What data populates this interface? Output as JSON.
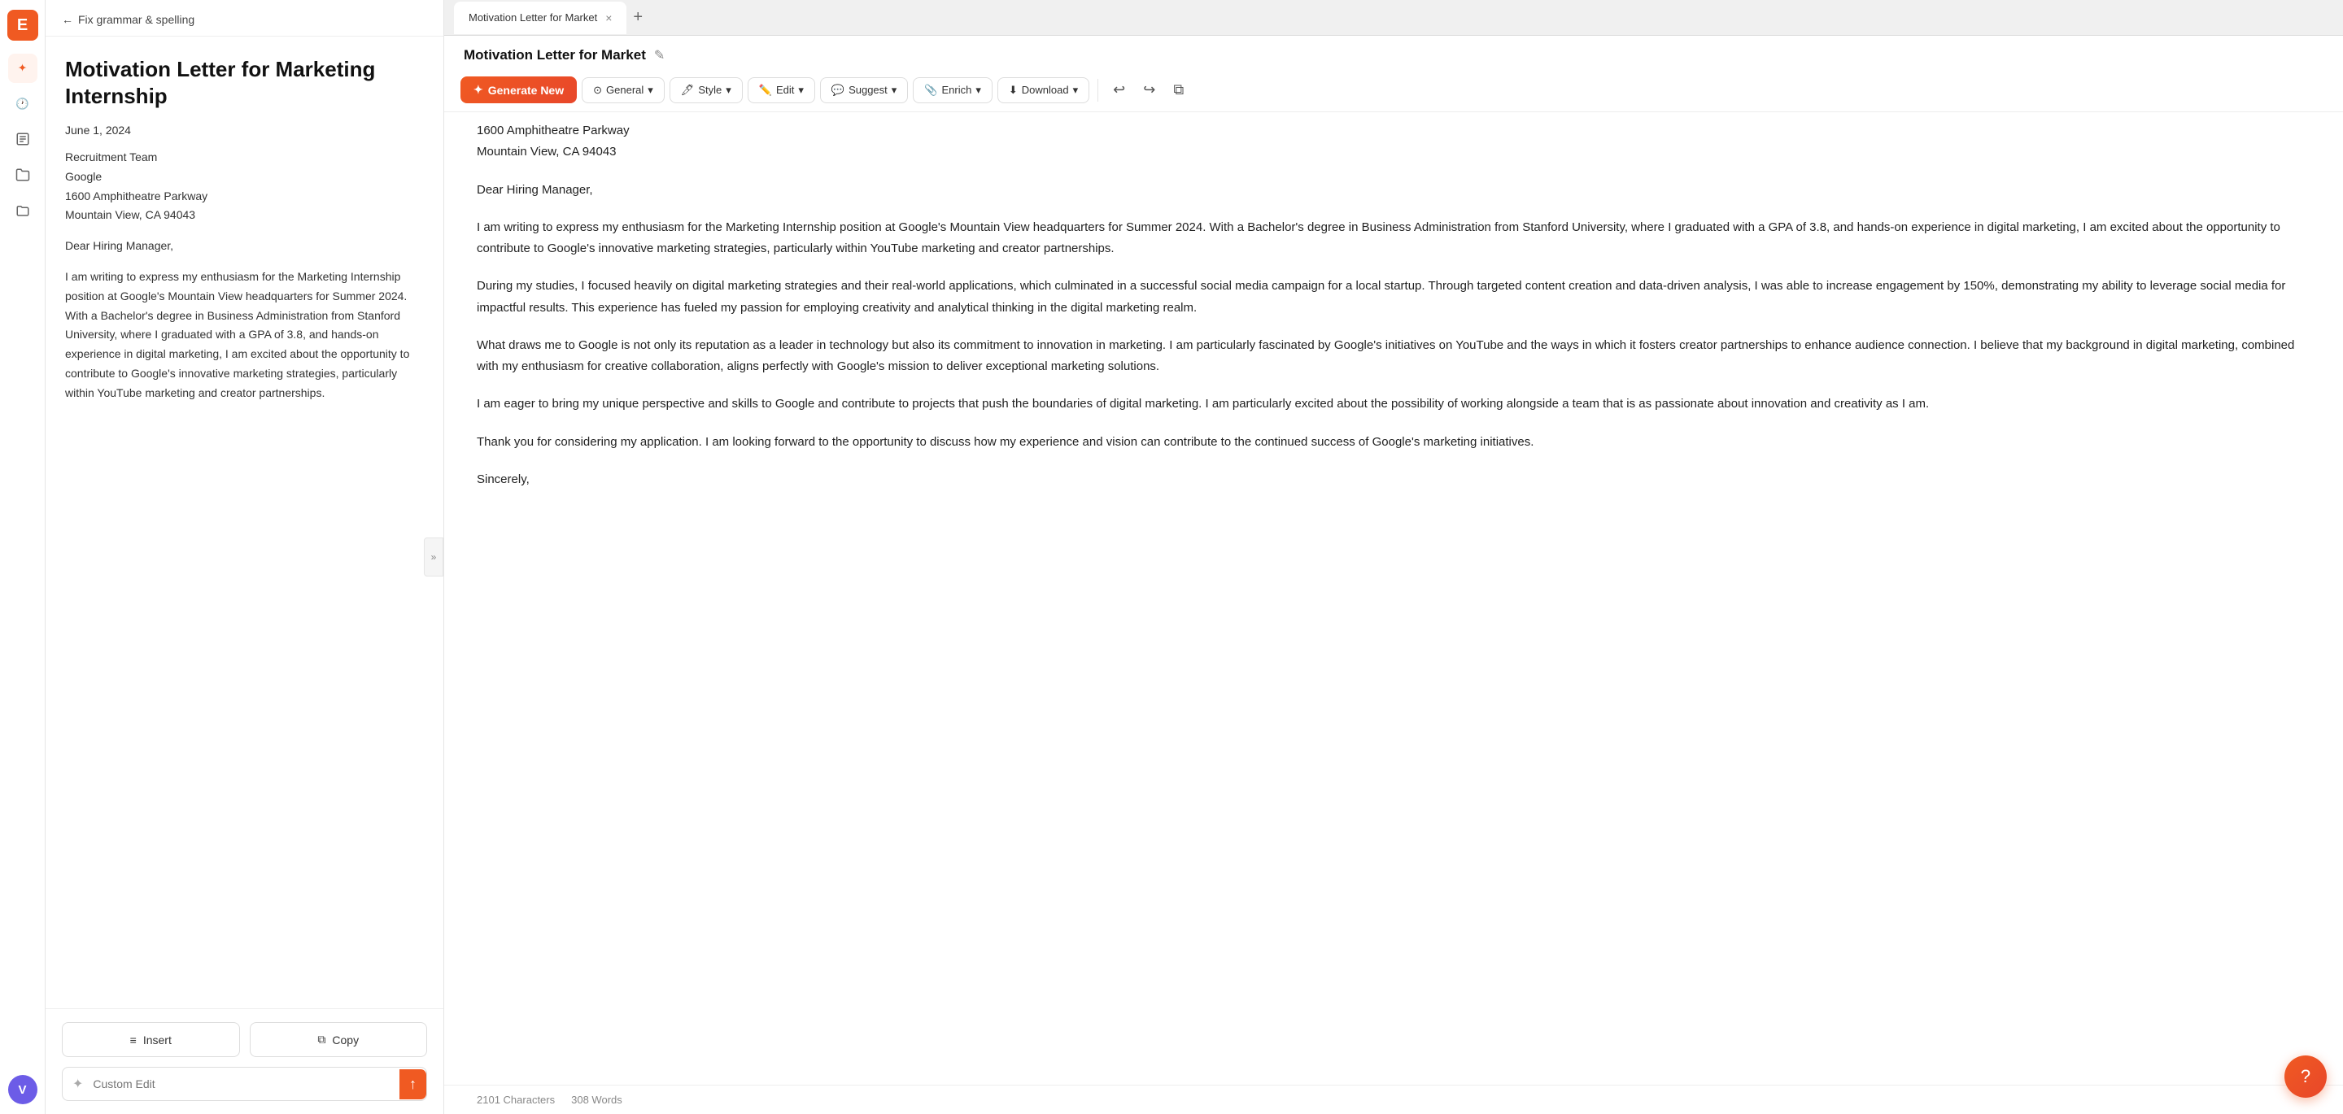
{
  "app": {
    "logo": "E",
    "sidebar_items": [
      {
        "name": "magic-wand",
        "icon": "✦",
        "active": true
      },
      {
        "name": "history",
        "icon": "🕐",
        "active": false
      },
      {
        "name": "documents",
        "icon": "📄",
        "active": false
      },
      {
        "name": "folder1",
        "icon": "📁",
        "active": false
      },
      {
        "name": "folder2",
        "icon": "📁",
        "active": false
      }
    ],
    "user_initial": "V"
  },
  "left_panel": {
    "back_label": "Fix grammar & spelling",
    "doc_title": "Motivation Letter for Marketing Internship",
    "doc_date": "June 1, 2024",
    "recipient_line1": "Recruitment Team",
    "recipient_line2": "Google",
    "recipient_line3": "1600 Amphitheatre Parkway",
    "recipient_line4": "Mountain View, CA 94043",
    "greeting": "Dear Hiring Manager,",
    "paragraph1": "I am writing to express my enthusiasm for the Marketing Internship position at Google's Mountain View headquarters for Summer 2024. With a Bachelor's degree in Business Administration from Stanford University, where I graduated with a GPA of 3.8, and hands-on experience in digital marketing, I am excited about the opportunity to contribute to Google's innovative marketing strategies, particularly within YouTube marketing and creator partnerships.",
    "insert_label": "Insert",
    "copy_label": "Copy",
    "custom_edit_placeholder": "Custom Edit",
    "send_icon": "↑"
  },
  "tab": {
    "title": "Motivation Letter for Market",
    "close_icon": "×",
    "add_icon": "+"
  },
  "toolbar": {
    "generate_label": "Generate New",
    "generate_icon": "✦",
    "general_label": "General",
    "style_label": "Style",
    "edit_label": "Edit",
    "suggest_label": "Suggest",
    "enrich_label": "Enrich",
    "download_label": "Download",
    "chevron_down": "▾",
    "undo_icon": "↩",
    "redo_icon": "↪",
    "copy_icon": "⧉"
  },
  "document": {
    "title": "Motivation Letter for Market",
    "edit_icon": "✎",
    "address_line1": "1600 Amphitheatre Parkway",
    "address_line2": "Mountain View, CA 94043",
    "greeting": "Dear Hiring Manager,",
    "paragraph1": "I am writing to express my enthusiasm for the Marketing Internship position at Google's Mountain View headquarters for Summer 2024. With a Bachelor's degree in Business Administration from Stanford University, where I graduated with a GPA of 3.8, and hands-on experience in digital marketing, I am excited about the opportunity to contribute to Google's innovative marketing strategies, particularly within YouTube marketing and creator partnerships.",
    "paragraph2": "During my studies, I focused heavily on digital marketing strategies and their real-world applications, which culminated in a successful social media campaign for a local startup. Through targeted content creation and data-driven analysis, I was able to increase engagement by 150%, demonstrating my ability to leverage social media for impactful results. This experience has fueled my passion for employing creativity and analytical thinking in the digital marketing realm.",
    "paragraph3": "What draws me to Google is not only its reputation as a leader in technology but also its commitment to innovation in marketing. I am particularly fascinated by Google's initiatives on YouTube and the ways in which it fosters creator partnerships to enhance audience connection. I believe that my background in digital marketing, combined with my enthusiasm for creative collaboration, aligns perfectly with Google's mission to deliver exceptional marketing solutions.",
    "paragraph4": "I am eager to bring my unique perspective and skills to Google and contribute to projects that push the boundaries of digital marketing. I am particularly excited about the possibility of working alongside a team that is as passionate about innovation and creativity as I am.",
    "paragraph5": "Thank you for considering my application. I am looking forward to the opportunity to discuss how my experience and vision can contribute to the continued success of Google's marketing initiatives.",
    "closing": "Sincerely,",
    "char_count": "2101 Characters",
    "word_count": "308 Words"
  }
}
